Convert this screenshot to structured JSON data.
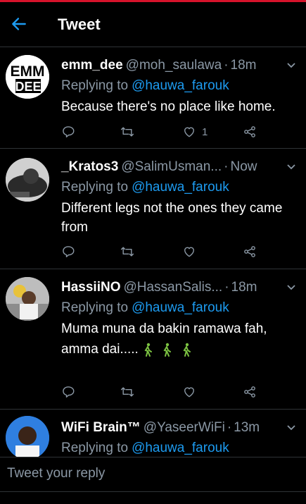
{
  "header": {
    "title": "Tweet"
  },
  "tweets": [
    {
      "name": "emm_dee",
      "handle": "@moh_saulawa",
      "time": "18m",
      "replying_prefix": "Replying to",
      "mention": "@hauwa_farouk",
      "text": "Because there's no place like home.",
      "like_count": "1",
      "avatar_text": "EMM DEE"
    },
    {
      "name": "_Kratos3",
      "handle": "@SalimUsman...",
      "time": "Now",
      "replying_prefix": "Replying to",
      "mention": "@hauwa_farouk",
      "text": "Different legs not the ones they came from",
      "like_count": ""
    },
    {
      "name": "HassiiNO",
      "handle": "@HassanSalis...",
      "time": "18m",
      "replying_prefix": "Replying to",
      "mention": "@hauwa_farouk",
      "text": "Muma muna da bakin ramawa fah, amma dai.....",
      "like_count": ""
    },
    {
      "name": "WiFi Brain™",
      "handle": "@YaseerWiFi",
      "time": "13m",
      "replying_prefix": "Replying to",
      "mention": "@hauwa_farouk"
    }
  ],
  "compose": {
    "placeholder": "Tweet your reply"
  },
  "colors": {
    "accent": "#1d9bf0",
    "muted": "#8b98a5",
    "background": "#000000",
    "top_stripe": "#d6132b"
  }
}
